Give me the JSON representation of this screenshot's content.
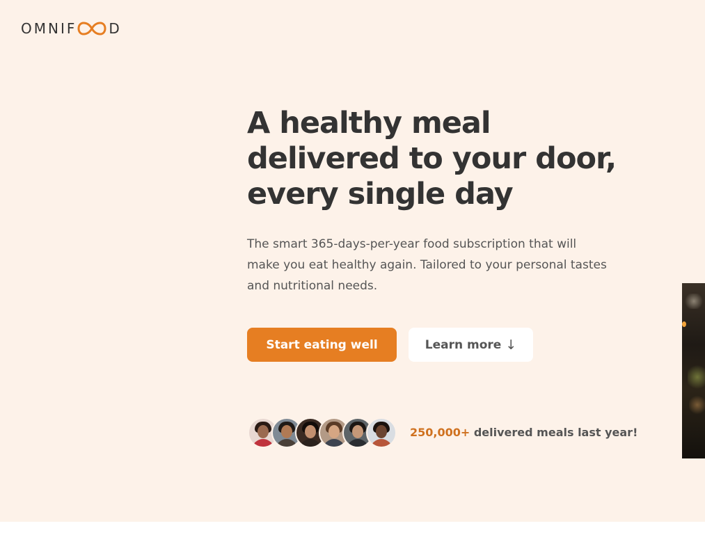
{
  "brand": {
    "logo_prefix": "OMNIF",
    "logo_suffix": "D",
    "logo_icon": "infinity-oo-icon",
    "accent_color": "#e67e22",
    "background_color": "#fdf2e9"
  },
  "hero": {
    "title": "A healthy meal delivered to your door, every single day",
    "description": "The smart 365-days-per-year food subscription that will make you eat healthy again. Tailored to your personal tastes and nutritional needs.",
    "cta_primary": "Start eating well",
    "cta_secondary": "Learn more",
    "cta_secondary_icon": "↓",
    "customers": {
      "avatar_count": 6,
      "count_text": "250,000+",
      "text": " delivered meals last year!"
    }
  }
}
